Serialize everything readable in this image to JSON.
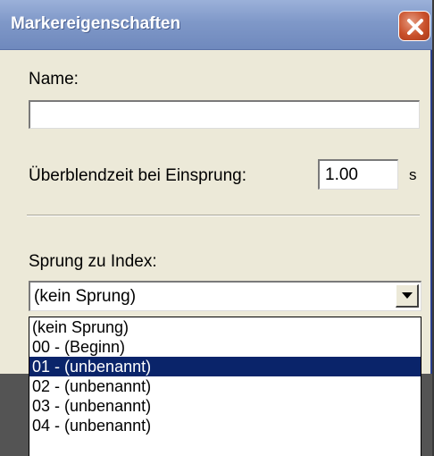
{
  "window": {
    "title": "Markereigenschaften"
  },
  "icons": {
    "close": "close-x-icon",
    "dropdown": "triangle-down-icon"
  },
  "form": {
    "name_label": "Name:",
    "name_value": "",
    "fade_label": "Überblendzeit bei Einsprung:",
    "fade_value": "1.00",
    "fade_unit": "s",
    "jump_label": "Sprung zu Index:",
    "jump_selected": "(kein Sprung)"
  },
  "dropdown": {
    "options": [
      "(kein Sprung)",
      "00 - (Beginn)",
      "01 - (unbenannt)",
      "02 - (unbenannt)",
      "03 - (unbenannt)",
      "04 - (unbenannt)"
    ],
    "highlighted_index": 2
  },
  "colors": {
    "title_bar": "#7f98c8",
    "selection": "#0a246a",
    "dialog_bg": "#ece9d8"
  }
}
